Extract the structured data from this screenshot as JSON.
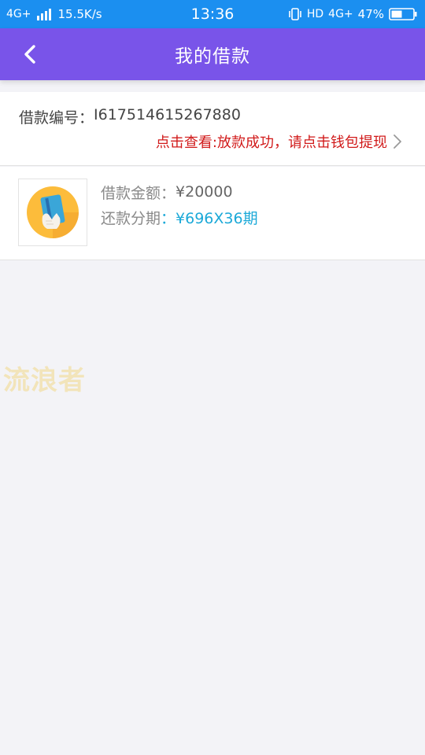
{
  "status_bar": {
    "network": "4G+",
    "speed": "15.5K/s",
    "time": "13:36",
    "hd": "HD",
    "network_right": "4G+",
    "battery": "47%"
  },
  "header": {
    "title": "我的借款"
  },
  "loan": {
    "number_label": "借款编号：",
    "number_value": "I617514615267880",
    "status_text": "点击查看:放款成功，请点击钱包提现"
  },
  "detail": {
    "amount_label": "借款金额：",
    "amount_value": "¥20000",
    "installment_label": "还款分期",
    "installment_colon": "：",
    "installment_value": "¥696X36期"
  },
  "watermark": {
    "text": "流浪者"
  },
  "colors": {
    "status_bar_bg": "#1b8ff0",
    "header_bg": "#7954e9",
    "status_red": "#d11a1a",
    "installment_cyan": "#1ba9d8",
    "page_bg": "#f3f3f7"
  },
  "icons": {
    "back": "chevron-left-icon",
    "status_link": "chevron-right-icon",
    "thumbnail": "card-hand-icon"
  }
}
